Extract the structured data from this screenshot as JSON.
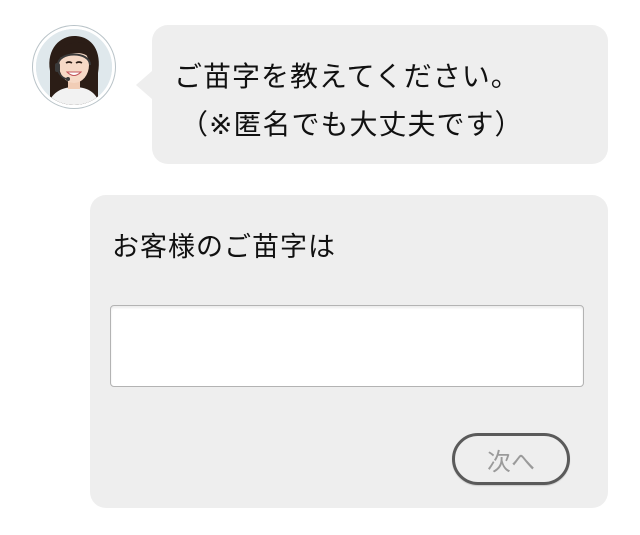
{
  "operator": {
    "avatar_icon": "operator-headset-avatar",
    "message_line1": "ご苗字を教えてください。",
    "message_line2": "（※匿名でも大丈夫です）"
  },
  "form": {
    "label": "お客様のご苗字は",
    "surname_value": "",
    "surname_placeholder": "",
    "next_label": "次へ"
  },
  "colors": {
    "bubble_bg": "#eeeeee",
    "button_border": "#5a5a5a",
    "button_text": "#9a9a9a"
  }
}
